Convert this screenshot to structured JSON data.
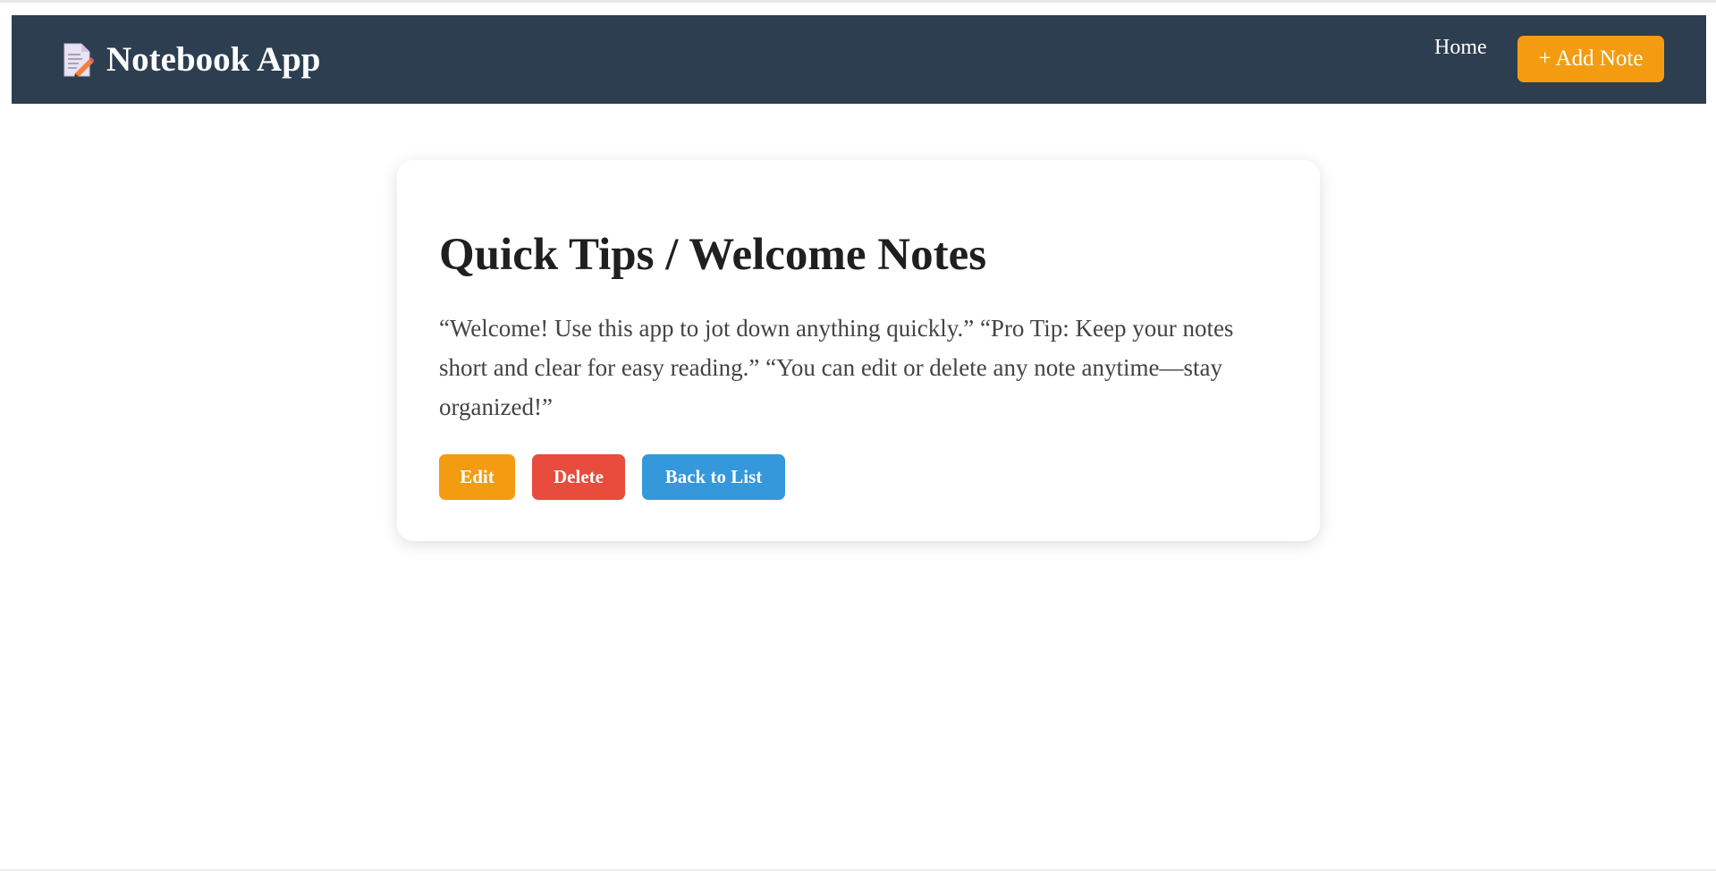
{
  "navbar": {
    "brand_icon": "memo-icon",
    "brand_title": "Notebook App",
    "home_label": "Home",
    "add_note_label": "+ Add Note",
    "background_color": "#2e3e51",
    "accent_color": "#f39c12"
  },
  "note": {
    "title": "Quick Tips / Welcome Notes",
    "body": "“Welcome! Use this app to jot down anything quickly.” “Pro Tip: Keep your notes short and clear for easy reading.” “You can edit or delete any note anytime—stay organized!”",
    "actions": {
      "edit_label": "Edit",
      "delete_label": "Delete",
      "back_label": "Back to List"
    },
    "colors": {
      "edit": "#f39c12",
      "delete": "#e74c3c",
      "back": "#3498db"
    }
  }
}
